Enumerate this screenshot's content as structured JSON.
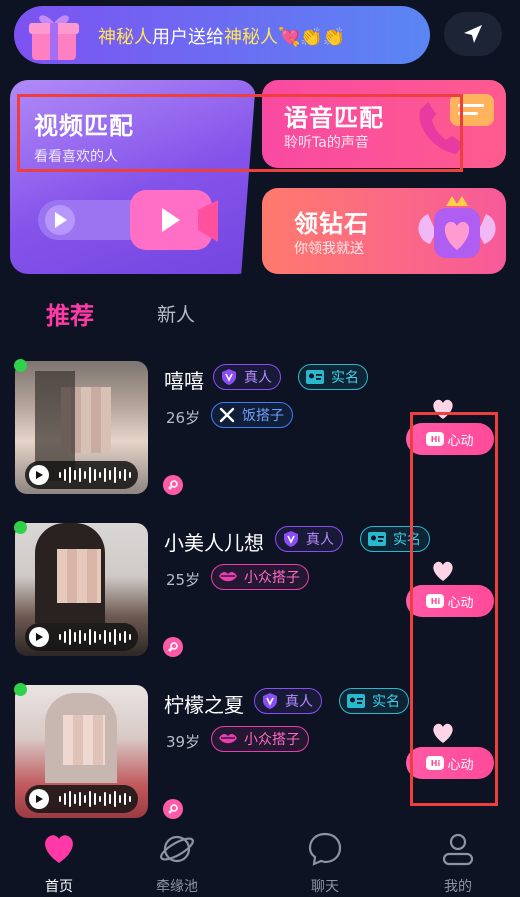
{
  "banner": {
    "parts": [
      "神秘人",
      "用户送给",
      "神秘人"
    ],
    "emoji": "💘👏👏"
  },
  "cards": {
    "video": {
      "title": "视频匹配",
      "sub": "看看喜欢的人"
    },
    "voice": {
      "title": "语音匹配",
      "sub": "聆听Ta的声音"
    },
    "diamond": {
      "title": "领钻石",
      "sub": "你领我就送"
    }
  },
  "tabs": {
    "recommend": "推荐",
    "new": "新人"
  },
  "users": [
    {
      "name": "嘻嘻",
      "real": "真人",
      "verified": "实名",
      "age": "26岁",
      "tag": "饭搭子",
      "like": "心动",
      "hi": "Hi"
    },
    {
      "name": "小美人儿想",
      "real": "真人",
      "verified": "实名",
      "age": "25岁",
      "tag": "小众搭子",
      "like": "心动",
      "hi": "Hi"
    },
    {
      "name": "柠檬之夏",
      "real": "真人",
      "verified": "实名",
      "age": "39岁",
      "tag": "小众搭子",
      "like": "心动",
      "hi": "Hi"
    }
  ],
  "nav": {
    "home": "首页",
    "pool": "牵缘池",
    "chat": "聊天",
    "me": "我的"
  },
  "colors": {
    "accent": "#ff3aa7",
    "background": "#0d1323",
    "highlight": "#ef3e3e"
  }
}
